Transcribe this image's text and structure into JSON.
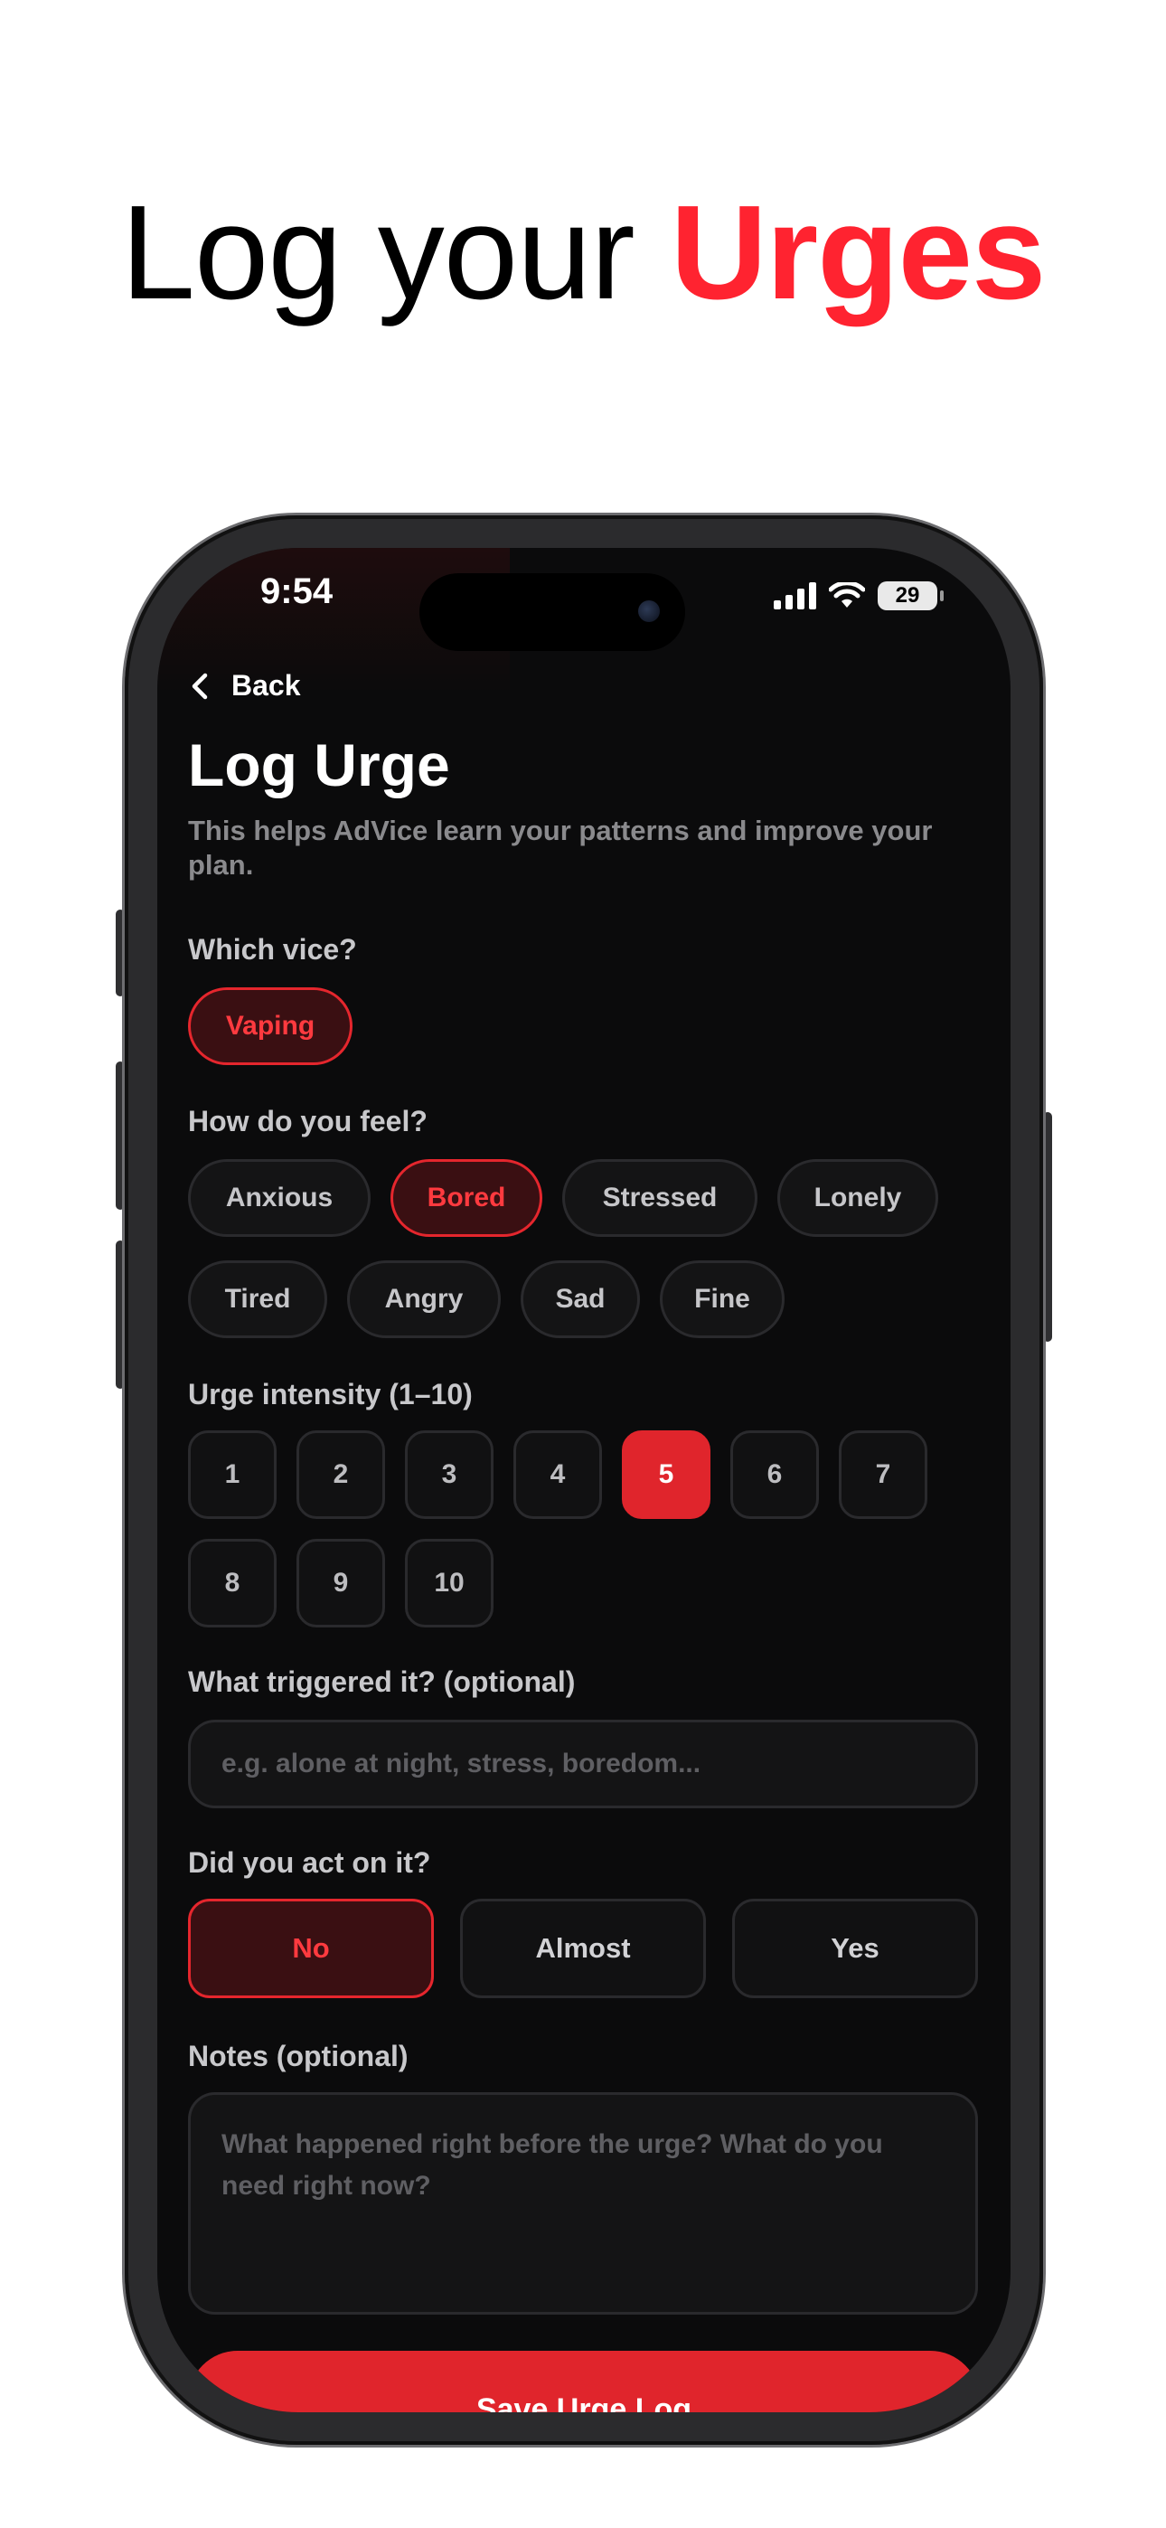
{
  "headline": {
    "plain": "Log your ",
    "accent": "Urges"
  },
  "status_bar": {
    "time": "9:54",
    "battery": "29"
  },
  "nav": {
    "back_label": "Back"
  },
  "page": {
    "title": "Log Urge",
    "subtitle": "This helps AdVice learn your patterns and improve your plan."
  },
  "vice": {
    "label": "Which vice?",
    "options": [
      "Vaping"
    ],
    "selected": "Vaping"
  },
  "feel": {
    "label": "How do you feel?",
    "options": [
      "Anxious",
      "Bored",
      "Stressed",
      "Lonely",
      "Tired",
      "Angry",
      "Sad",
      "Fine"
    ],
    "selected": "Bored"
  },
  "intensity": {
    "label": "Urge intensity (1–10)",
    "options": [
      "1",
      "2",
      "3",
      "4",
      "5",
      "6",
      "7",
      "8",
      "9",
      "10"
    ],
    "selected": "5"
  },
  "trigger": {
    "label": "What triggered it? (optional)",
    "placeholder": "e.g. alone at night, stress, boredom..."
  },
  "acted": {
    "label": "Did you act on it?",
    "options": [
      "No",
      "Almost",
      "Yes"
    ],
    "selected": "No"
  },
  "notes": {
    "label": "Notes (optional)",
    "placeholder": "What happened right before the urge? What do you need right now?"
  },
  "save_label": "Save Urge Log",
  "colors": {
    "accent": "#e0252c",
    "background": "#0b0b0c"
  }
}
